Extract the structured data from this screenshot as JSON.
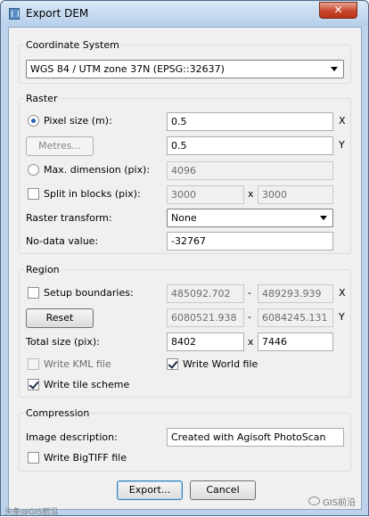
{
  "window": {
    "title": "Export DEM",
    "close_glyph": "✕"
  },
  "coordinate_system": {
    "title": "Coordinate System",
    "selected": "WGS 84 / UTM zone 37N (EPSG::32637)"
  },
  "raster": {
    "title": "Raster",
    "pixel_size_label": "Pixel size (m):",
    "pixel_size_x": "0.5",
    "pixel_size_y": "0.5",
    "axis_x": "X",
    "axis_y": "Y",
    "metres_button": "Metres...",
    "max_dimension_label": "Max. dimension (pix):",
    "max_dimension_value": "4096",
    "split_label": "Split in blocks (pix):",
    "split_x": "3000",
    "split_y": "3000",
    "split_sep": "x",
    "transform_label": "Raster transform:",
    "transform_value": "None",
    "nodata_label": "No-data value:",
    "nodata_value": "-32767"
  },
  "region": {
    "title": "Region",
    "setup_label": "Setup boundaries:",
    "x_min": "485092.702",
    "x_max": "489293.939",
    "y_min": "6080521.938",
    "y_max": "6084245.131",
    "range_sep": "-",
    "axis_x": "X",
    "axis_y": "Y",
    "reset_button": "Reset",
    "total_size_label": "Total size (pix):",
    "total_w": "8402",
    "total_h": "7446",
    "size_sep": "x",
    "kml_label": "Write KML file",
    "world_label": "Write World file",
    "tile_label": "Write tile scheme"
  },
  "compression": {
    "title": "Compression",
    "description_label": "Image description:",
    "description_value": "Created with Agisoft PhotoScan",
    "bigtiff_label": "Write BigTIFF file"
  },
  "buttons": {
    "export": "Export...",
    "cancel": "Cancel"
  },
  "watermark": {
    "left": "头条@GIS前沿",
    "right": "GIS前沿"
  }
}
